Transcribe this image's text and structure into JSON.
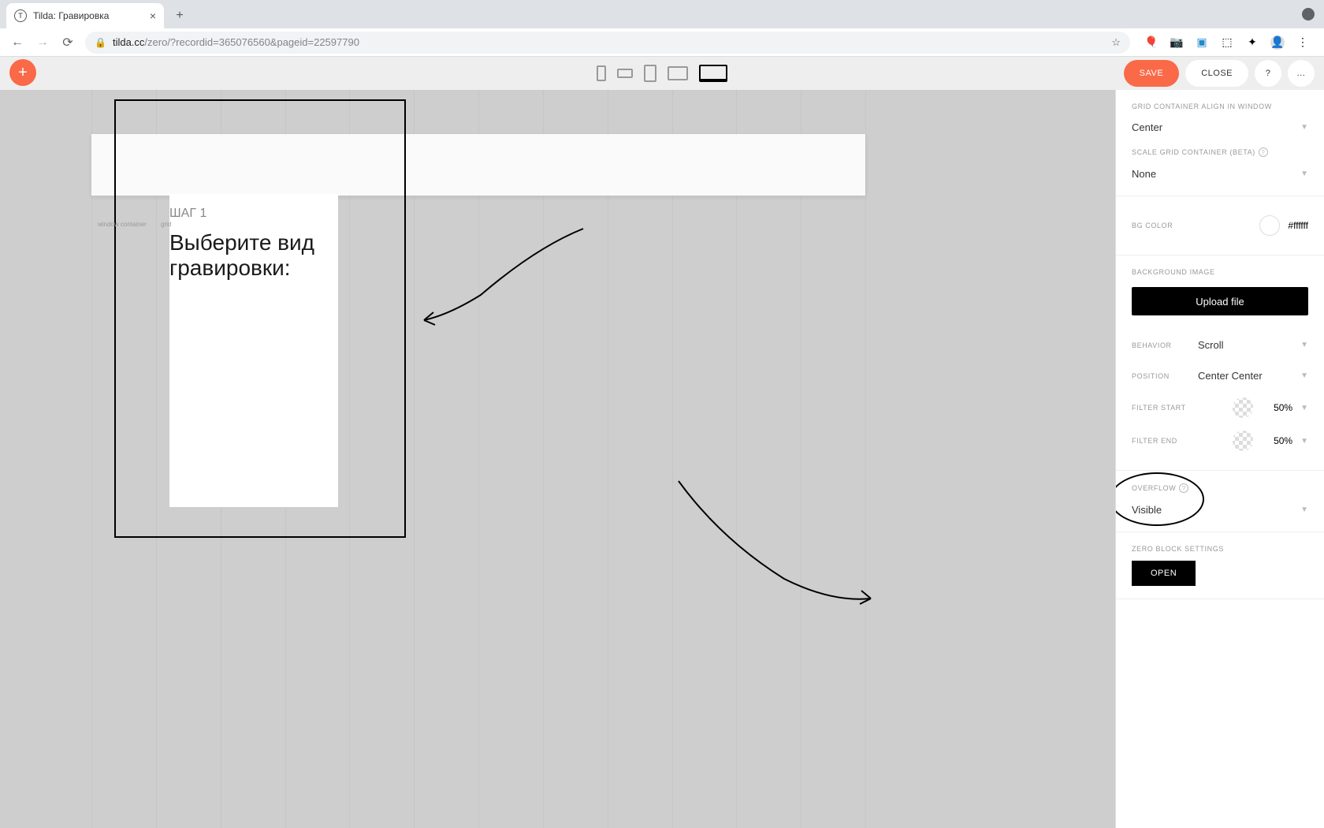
{
  "browser": {
    "tab_title": "Tilda: Гравировка",
    "url_host": "tilda.cc",
    "url_path": "/zero/?recordid=365076560&pageid=22597790"
  },
  "toolbar": {
    "save": "SAVE",
    "close": "CLOSE",
    "more": "..."
  },
  "canvas": {
    "step_label": "ШАГ 1",
    "heading": "Выберите вид\nгравировки:",
    "tag_window": "window container",
    "tag_grid": "grid"
  },
  "sidebar": {
    "grid_align": {
      "label": "GRID CONTAINER ALIGN IN WINDOW",
      "value": "Center"
    },
    "scale_grid": {
      "label": "SCALE GRID CONTAINER (BETA)",
      "value": "None"
    },
    "bg_color": {
      "label": "BG COLOR",
      "value": "#ffffff"
    },
    "bg_image": {
      "label": "BACKGROUND IMAGE",
      "button": "Upload file"
    },
    "behavior": {
      "label": "BEHAVIOR",
      "value": "Scroll"
    },
    "position": {
      "label": "POSITION",
      "value": "Center Center"
    },
    "filter_start": {
      "label": "FILTER START",
      "value": "50%"
    },
    "filter_end": {
      "label": "FILTER END",
      "value": "50%"
    },
    "overflow": {
      "label": "OVERFLOW",
      "value": "Visible"
    },
    "zero_block": {
      "label": "ZERO BLOCK SETTINGS",
      "button": "OPEN"
    }
  }
}
